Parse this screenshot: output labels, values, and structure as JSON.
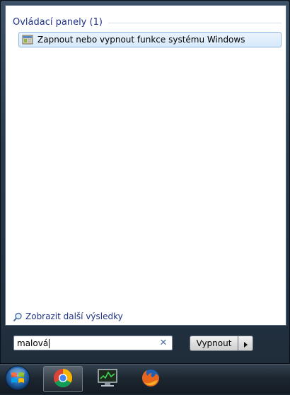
{
  "search_results": {
    "group_title": "Ovládací panely (1)",
    "items": [
      {
        "label": "Zapnout nebo vypnout funkce systému Windows"
      }
    ],
    "more_results_label": "Zobrazit další výsledky"
  },
  "search": {
    "value": "malová"
  },
  "power": {
    "shutdown_label": "Vypnout"
  },
  "taskbar": {
    "items": [
      {
        "name": "start-orb"
      },
      {
        "name": "chrome",
        "active": true
      },
      {
        "name": "task-manager"
      },
      {
        "name": "firefox"
      }
    ]
  }
}
